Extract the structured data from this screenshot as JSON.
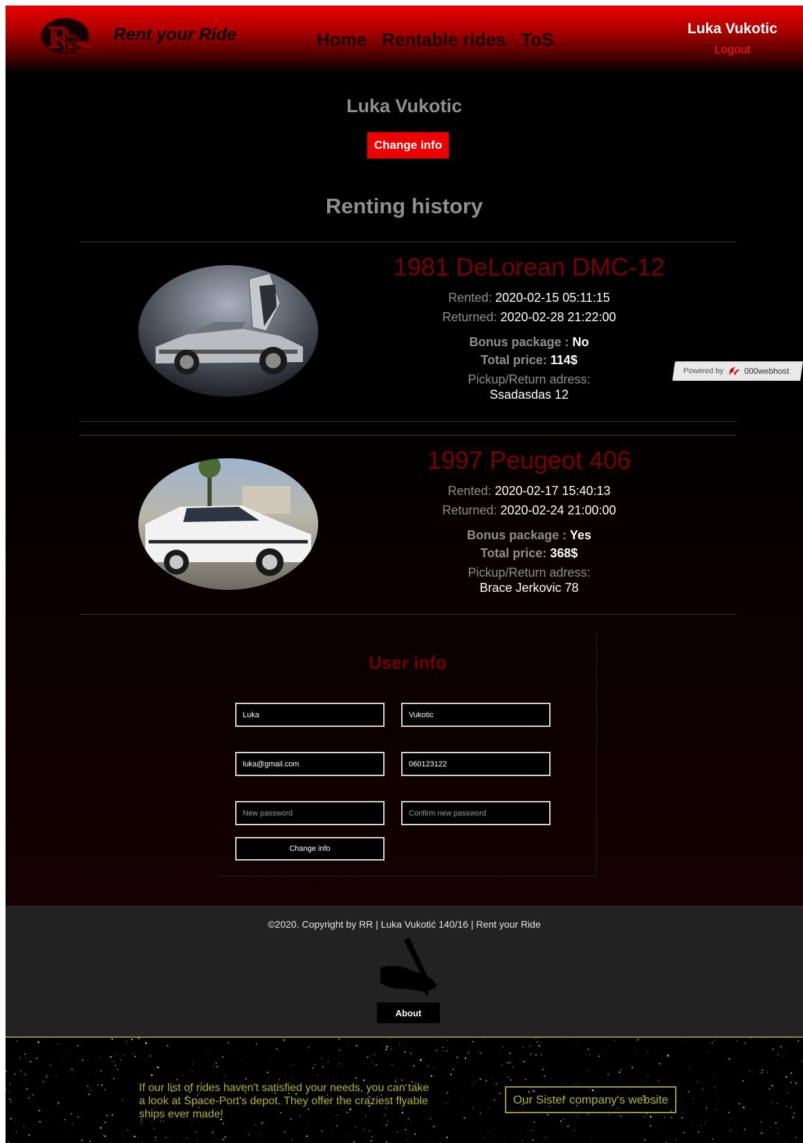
{
  "header": {
    "logo_text": "R",
    "brand": "Rent your Ride",
    "nav": [
      "Home",
      "Rentable rides",
      "ToS"
    ],
    "username": "Luka Vukotic",
    "logout": "Logout"
  },
  "profile": {
    "name": "Luka Vukotic",
    "change_info_label": "Change info",
    "history_title": "Renting history"
  },
  "labels": {
    "rented": "Rented:",
    "returned": "Returned:",
    "bonus": "Bonus package :",
    "total": "Total price:",
    "pickup": "Pickup/Return adress:"
  },
  "rentals": [
    {
      "car": "1981 DeLorean DMC-12",
      "rented": "2020-02-15 05:11:15",
      "returned": "2020-02-28 21:22:00",
      "bonus": "No",
      "total": "114$",
      "address": "Ssadasdas 12"
    },
    {
      "car": "1997 Peugeot 406",
      "rented": "2020-02-17 15:40:13",
      "returned": "2020-02-24 21:00:00",
      "bonus": "Yes",
      "total": "368$",
      "address": "Brace Jerkovic 78"
    }
  ],
  "user_info": {
    "title": "User info",
    "first_name": "Luka",
    "last_name": "Vukotic",
    "email": "luka@gmail.com",
    "phone": "060123122",
    "new_password_placeholder": "New password",
    "confirm_password_placeholder": "Confirm new password",
    "submit": "Change info"
  },
  "footer": {
    "copyright": "©2020. Copyright by RR | Luka Vukotić 140/16 | Rent your Ride",
    "about": "About"
  },
  "space_banner": {
    "text": "If our list of rides haven't satisfied your needs, you can take a look at Space-Port's depot. They offer the craziest flyable ships ever made!",
    "button": "Our Sister company's website"
  },
  "powered_badge": {
    "label": "Powered by",
    "brand": "000webhost"
  },
  "colors": {
    "accent": "#ee0000",
    "car_title": "#780000",
    "space_text": "#b3b32a"
  }
}
